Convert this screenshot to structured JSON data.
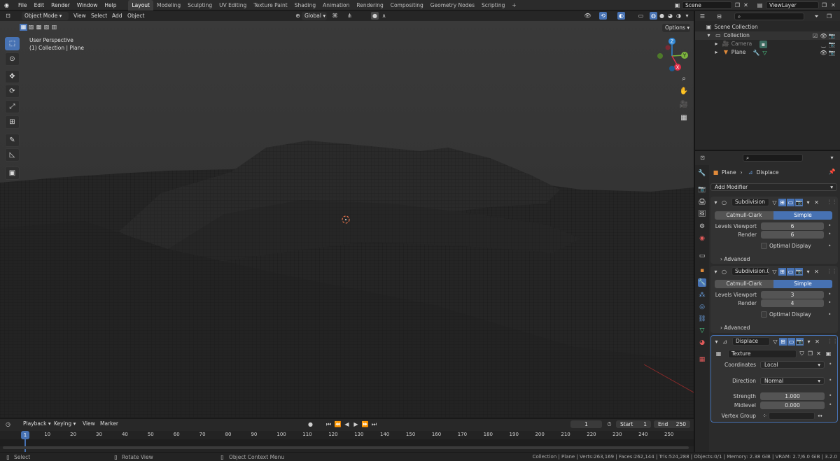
{
  "topbar": {
    "menus": [
      "File",
      "Edit",
      "Render",
      "Window",
      "Help"
    ],
    "workspaces": [
      "Layout",
      "Modeling",
      "Sculpting",
      "UV Editing",
      "Texture Paint",
      "Shading",
      "Animation",
      "Rendering",
      "Compositing",
      "Geometry Nodes",
      "Scripting"
    ],
    "active_workspace": "Layout",
    "add_tab": "+",
    "scene": "Scene",
    "view_layer": "ViewLayer"
  },
  "viewport_header": {
    "mode": "Object Mode",
    "menus": [
      "View",
      "Select",
      "Add",
      "Object"
    ],
    "orientation": "Global",
    "options": "Options"
  },
  "viewport": {
    "perspective": "User Perspective",
    "collection_line": "(1) Collection | Plane",
    "gizmo_axes": {
      "x": "X",
      "y": "Y",
      "z": "Z"
    }
  },
  "timeline": {
    "menus": [
      "Playback",
      "Keying",
      "View",
      "Marker"
    ],
    "current_frame": "1",
    "start_label": "Start",
    "start": "1",
    "end_label": "End",
    "end": "250",
    "ticks": [
      "1",
      "10",
      "20",
      "30",
      "40",
      "50",
      "60",
      "70",
      "80",
      "90",
      "100",
      "110",
      "120",
      "130",
      "140",
      "150",
      "160",
      "170",
      "180",
      "190",
      "200",
      "210",
      "220",
      "230",
      "240",
      "250"
    ]
  },
  "status": {
    "select": "Select",
    "rotate": "Rotate View",
    "context": "Object Context Menu",
    "stats": "Collection | Plane | Verts:263,169 | Faces:262,144 | Tris:524,288 | Objects:0/1 | Memory: 2.38 GiB | VRAM: 2.7/6.0 GiB | 3.2.0"
  },
  "outliner": {
    "scene_collection": "Scene Collection",
    "collection": "Collection",
    "camera": "Camera",
    "plane": "Plane"
  },
  "properties": {
    "breadcrumb_object": "Plane",
    "breadcrumb_modifier": "Displace",
    "add_modifier": "Add Modifier",
    "modifiers": [
      {
        "name": "Subdivision",
        "type_left": "Catmull-Clark",
        "type_right": "Simple",
        "levels_label": "Levels Viewport",
        "levels": "6",
        "render_label": "Render",
        "render": "6",
        "optimal": "Optimal Display",
        "advanced": "Advanced"
      },
      {
        "name": "Subdivision.0...",
        "type_left": "Catmull-Clark",
        "type_right": "Simple",
        "levels_label": "Levels Viewport",
        "levels": "3",
        "render_label": "Render",
        "render": "4",
        "optimal": "Optimal Display",
        "advanced": "Advanced"
      }
    ],
    "displace": {
      "name": "Displace",
      "texture": "Texture",
      "coords_label": "Coordinates",
      "coords": "Local",
      "direction_label": "Direction",
      "direction": "Normal",
      "strength_label": "Strength",
      "strength": "1.000",
      "midlevel_label": "Midlevel",
      "midlevel": "0.000",
      "vgroup_label": "Vertex Group"
    }
  },
  "colors": {
    "accent": "#4772b3",
    "x_axis": "#e0304a",
    "y_axis": "#7bb33e",
    "z_axis": "#2f86d4"
  }
}
